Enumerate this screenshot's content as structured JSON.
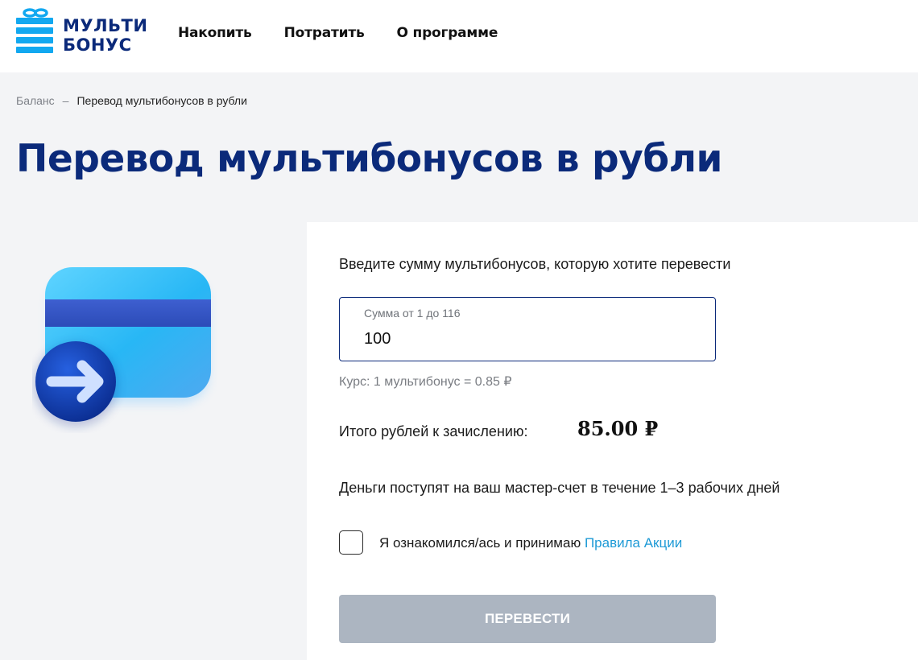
{
  "brand": {
    "line1": "МУЛЬТИ",
    "line2": "БОНУС",
    "color": "#0b2a7a",
    "icon_color": "#12a8f0"
  },
  "nav": {
    "items": [
      "Накопить",
      "Потратить",
      "О программе"
    ]
  },
  "breadcrumb": {
    "parent": "Баланс",
    "separator": "–",
    "current": "Перевод мультибонусов в рубли"
  },
  "page": {
    "title": "Перевод мультибонусов в рубли"
  },
  "form": {
    "prompt": "Введите сумму мультибонусов, которую хотите перевести",
    "amount_label": "Сумма от 1 до 116",
    "amount_value": "100",
    "rate": "Курс: 1 мультибонус = 0.85 ₽",
    "total_label": "Итого рублей к зачислению:",
    "total_value": "85.00 ₽",
    "notice": "Деньги поступят на ваш мастер-счет в течение 1–3 рабочих дней",
    "agree_text": "Я ознакомился/ась и принимаю",
    "agree_link": "Правила Акции",
    "agree_checked": false,
    "submit_label": "ПЕРЕВЕСТИ",
    "submit_disabled": true
  },
  "colors": {
    "accent": "#0b2a7a",
    "link": "#1e9ad6",
    "button_disabled": "#acb5c1",
    "background": "#f3f4f6"
  }
}
